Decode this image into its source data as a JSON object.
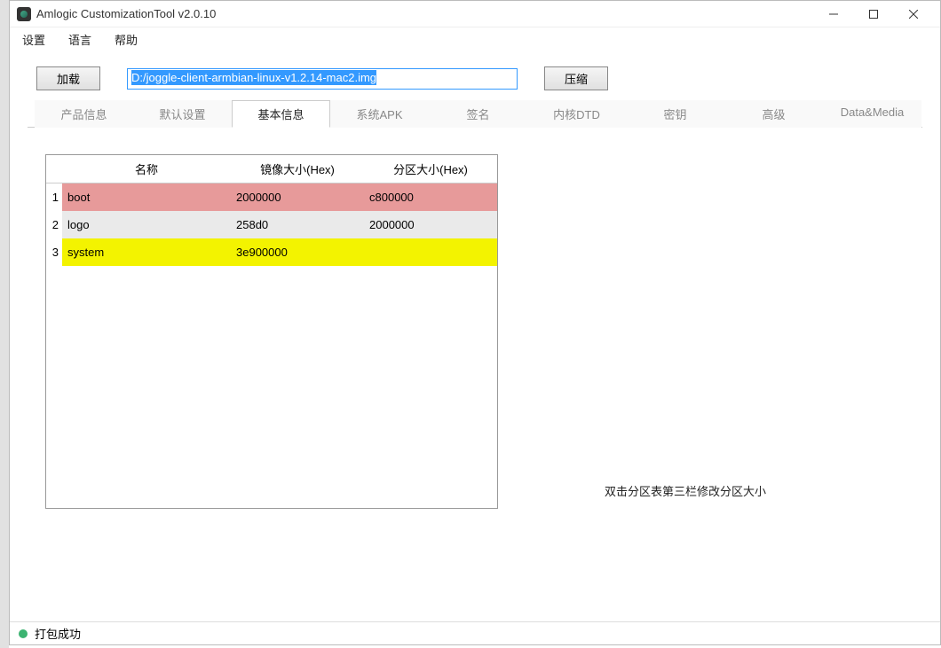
{
  "window": {
    "title": "Amlogic CustomizationTool v2.0.10"
  },
  "menu": {
    "settings": "设置",
    "language": "语言",
    "help": "帮助"
  },
  "toolbar": {
    "load_label": "加载",
    "compress_label": "压缩",
    "path_value": "D:/joggle-client-armbian-linux-v1.2.14-mac2.img"
  },
  "tabs": {
    "items": [
      {
        "label": "产品信息"
      },
      {
        "label": "默认设置"
      },
      {
        "label": "基本信息"
      },
      {
        "label": "系统APK"
      },
      {
        "label": "签名"
      },
      {
        "label": "内核DTD"
      },
      {
        "label": "密钥"
      },
      {
        "label": "高级"
      },
      {
        "label": "Data&Media"
      }
    ],
    "active_index": 2
  },
  "table": {
    "headers": {
      "name": "名称",
      "image_size": "镜像大小(Hex)",
      "partition_size": "分区大小(Hex)"
    },
    "rows": [
      {
        "idx": "1",
        "name": "boot",
        "img": "2000000",
        "part": "c800000",
        "color": "red"
      },
      {
        "idx": "2",
        "name": "logo",
        "img": "258d0",
        "part": "2000000",
        "color": "gray"
      },
      {
        "idx": "3",
        "name": "system",
        "img": "3e900000",
        "part": "",
        "color": "yellow"
      }
    ]
  },
  "hint": "双击分区表第三栏修改分区大小",
  "status": {
    "text": "打包成功"
  }
}
